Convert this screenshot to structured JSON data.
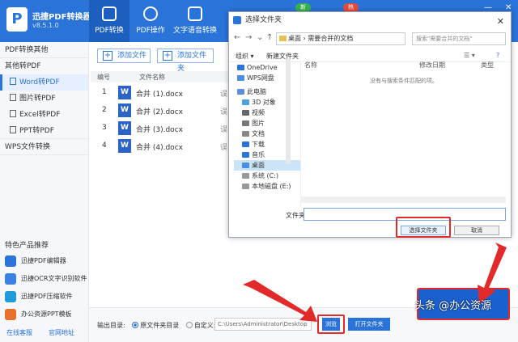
{
  "app": {
    "name": "迅捷PDF转换器",
    "version": "v8.5.1.0"
  },
  "nav_tabs": [
    "PDF转换",
    "PDF操作",
    "文字语音转换"
  ],
  "badges": [
    "新",
    "热"
  ],
  "window_controls": [
    "—",
    "✕"
  ],
  "sidebar": {
    "groups": [
      {
        "label": "PDF转换其他",
        "items": []
      },
      {
        "label": "其他转PDF",
        "items": [
          "Word转PDF",
          "图片转PDF",
          "Excel转PDF",
          "PPT转PDF"
        ]
      },
      {
        "label": "WPS文件转换",
        "items": []
      }
    ],
    "featured_title": "特色产品推荐",
    "featured": [
      "迅捷PDF编辑器",
      "迅捷OCR文字识别软件",
      "迅捷PDF压缩软件",
      "办公资源PPT模板"
    ],
    "footer": [
      "在线客服",
      "官网地址"
    ]
  },
  "toolbar": {
    "add_file": "添加文件",
    "add_folder": "添加文件夹"
  },
  "file_table": {
    "headers": [
      "编号",
      "文件名称"
    ],
    "rows": [
      {
        "num": "1",
        "name": "合并 (1).docx",
        "cut": "误"
      },
      {
        "num": "2",
        "name": "合并 (2).docx",
        "cut": "误"
      },
      {
        "num": "3",
        "name": "合并 (3).docx",
        "cut": "误"
      },
      {
        "num": "4",
        "name": "合并 (4).docx",
        "cut": "误"
      }
    ]
  },
  "bottom": {
    "output_label": "输出目录:",
    "opt_source": "原文件夹目录",
    "opt_custom": "自定义:",
    "path": "C:\\Users\\Administrator\\Desktop",
    "browse": "浏览",
    "open_folder": "打开文件夹"
  },
  "dialog": {
    "title": "选择文件夹",
    "path_parts": [
      "桌面",
      "需要合并的文档"
    ],
    "search_placeholder": "搜索\"需要合并的文档\"",
    "organize": "组织 ▾",
    "new_folder": "新建文件夹",
    "nav_items": [
      {
        "label": "OneDrive",
        "color": "#2a73d9",
        "indent": false,
        "selected": false
      },
      {
        "label": "WPS网盘",
        "color": "#4a90e2",
        "indent": false,
        "selected": false
      },
      {
        "label": "此电脑",
        "color": "#5b8fd9",
        "indent": false,
        "selected": false
      },
      {
        "label": "3D 对象",
        "color": "#4aa3df",
        "indent": true,
        "selected": false
      },
      {
        "label": "视频",
        "color": "#666666",
        "indent": true,
        "selected": false
      },
      {
        "label": "图片",
        "color": "#777777",
        "indent": true,
        "selected": false
      },
      {
        "label": "文档",
        "color": "#888888",
        "indent": true,
        "selected": false
      },
      {
        "label": "下载",
        "color": "#2a73d9",
        "indent": true,
        "selected": false
      },
      {
        "label": "音乐",
        "color": "#2a73d9",
        "indent": true,
        "selected": false
      },
      {
        "label": "桌面",
        "color": "#4a90e2",
        "indent": true,
        "selected": true
      },
      {
        "label": "系统 (C:)",
        "color": "#999999",
        "indent": true,
        "selected": false
      },
      {
        "label": "本地磁盘 (E:)",
        "color": "#999999",
        "indent": true,
        "selected": false
      }
    ],
    "columns": [
      "名称",
      "修改日期",
      "类型"
    ],
    "empty_message": "没有与搜索条件匹配的项。",
    "folder_label": "文件夹:",
    "select_button": "选择文件夹",
    "cancel_button": "取消"
  },
  "watermark": "头条 @办公资源",
  "colors": {
    "brand": "#2a73d9",
    "annotation": "#e32a2a"
  }
}
